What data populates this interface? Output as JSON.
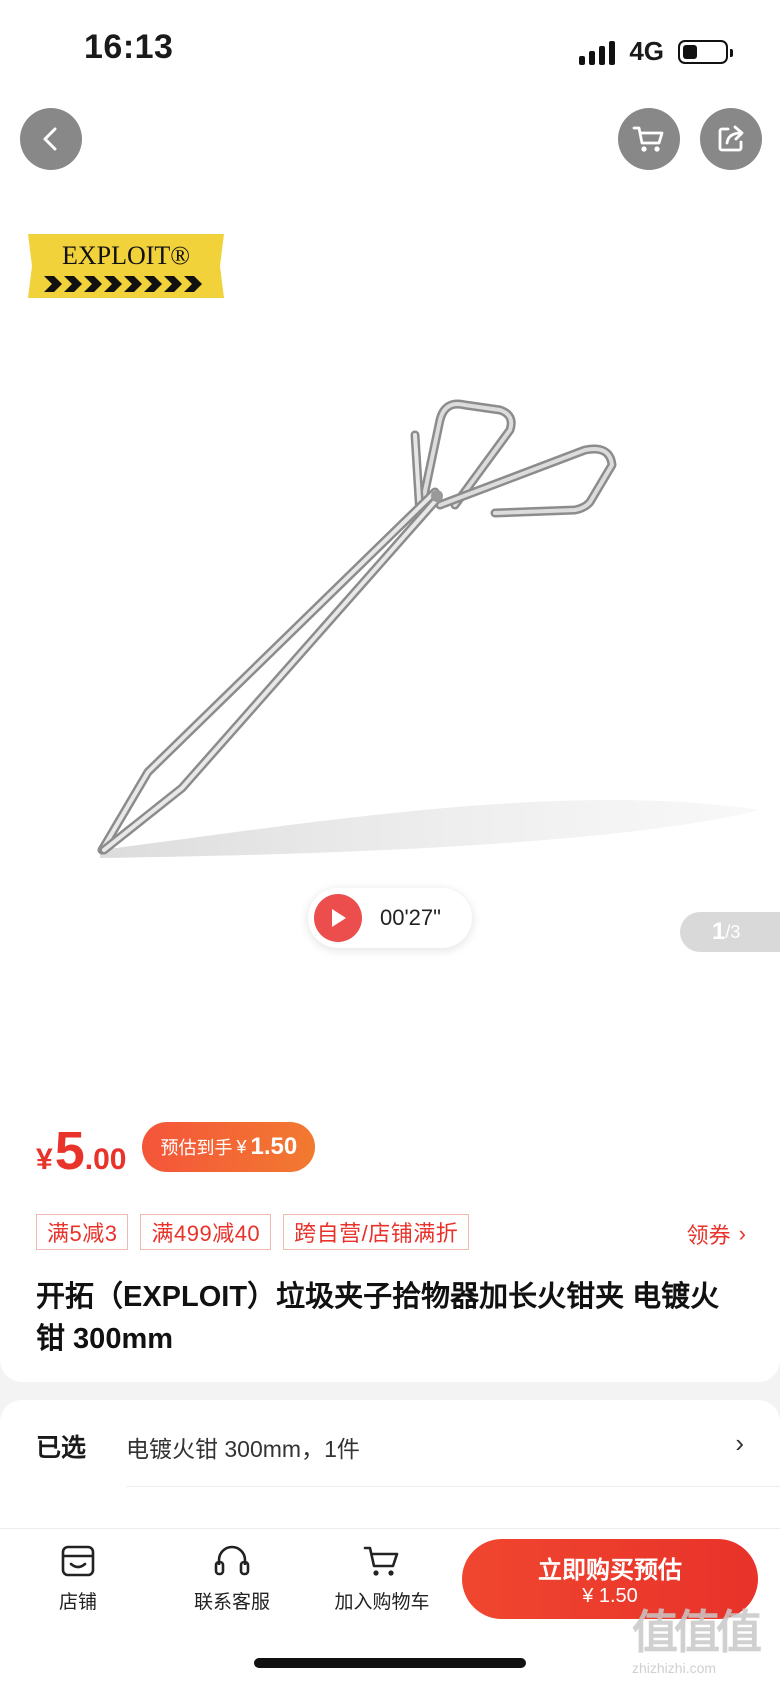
{
  "status_bar": {
    "time": "16:13",
    "network": "4G"
  },
  "nav": {
    "back_icon": "chevron-left-icon",
    "cart_icon": "cart-icon",
    "share_icon": "share-icon"
  },
  "gallery": {
    "brand_logo_text": "EXPLOIT®",
    "video_duration": "00'27\"",
    "page_current": "1",
    "page_total": "/3"
  },
  "price": {
    "currency": "¥",
    "integer": "5",
    "decimal": ".00",
    "estimate_label": "预估到手",
    "estimate_currency": "¥",
    "estimate_value": "1.50"
  },
  "promotions": {
    "tags": [
      "满5减3",
      "满499减40",
      "跨自营/店铺满折"
    ],
    "coupon_label": "领券",
    "coupon_chevron": "›"
  },
  "product": {
    "title": "开拓（EXPLOIT）垃圾夹子拾物器加长火钳夹 电镀火钳 300mm"
  },
  "selection": {
    "label": "已选",
    "value": "电镀火钳 300mm，1件",
    "chevron": "›"
  },
  "bottom_bar": {
    "store_label": "店铺",
    "service_label": "联系客服",
    "cart_label": "加入购物车",
    "buy_label": "立即购买预估",
    "buy_price": "¥ 1.50"
  },
  "watermark": {
    "mark": "值值值",
    "url": "zhizhizhi.com"
  },
  "colors": {
    "accent": "#e8322a",
    "gradient_end": "#f27a30",
    "logo_yellow": "#f2d23a"
  }
}
